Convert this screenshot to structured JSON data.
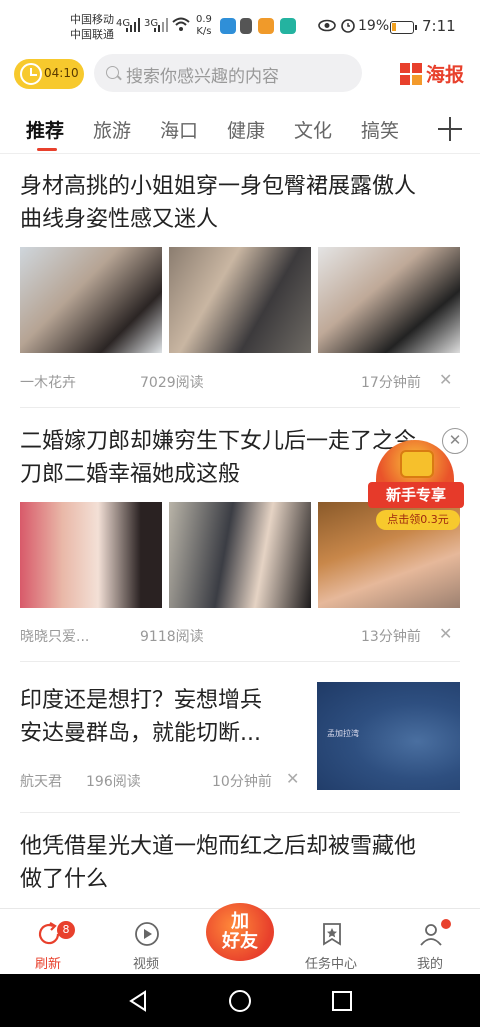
{
  "status_bar": {
    "carrier1": "中国移动",
    "carrier2": "中国联通",
    "net1": "4G",
    "net2": "3G",
    "speed_value": "0.9",
    "speed_unit": "K/s",
    "battery": "19%",
    "time": "7:11",
    "battery_level": 0.19
  },
  "header": {
    "timer": "04:10",
    "search_placeholder": "搜索你感兴趣的内容",
    "logo_text": "海报",
    "accent": "#e8402c"
  },
  "tabs": [
    {
      "label": "推荐",
      "active": true
    },
    {
      "label": "旅游"
    },
    {
      "label": "海口"
    },
    {
      "label": "健康"
    },
    {
      "label": "文化"
    },
    {
      "label": "搞笑"
    }
  ],
  "feed": [
    {
      "title_line1": "身材高挑的小姐姐穿一身包臀裙展露傲人",
      "title_line2": "曲线身姿性感又迷人",
      "author": "一木花卉",
      "reads": "7029阅读",
      "time": "17分钟前"
    },
    {
      "title_line1": "二婚嫁刀郎却嫌穷生下女儿后一走了之今",
      "title_line2": "刀郎二婚幸福她成这般",
      "author": "晓晓只爱...",
      "reads": "9118阅读",
      "time": "13分钟前"
    },
    {
      "title_line1": "印度还是想打？妄想增兵",
      "title_line2": "安达曼群岛，就能切断...",
      "author": "航天君",
      "reads": "196阅读",
      "time": "10分钟前",
      "map_label": "孟加拉湾"
    },
    {
      "title_line1": "他凭借星光大道一炮而红之后却被雪藏他",
      "title_line2": "做了什么"
    }
  ],
  "promo": {
    "title": "新手专享",
    "claim": "点击领0.3元"
  },
  "bottom_nav": {
    "refresh": "刷新",
    "refresh_badge": "8",
    "video": "视频",
    "add_friend_line1": "加",
    "add_friend_line2": "好友",
    "tasks": "任务中心",
    "me": "我的"
  }
}
